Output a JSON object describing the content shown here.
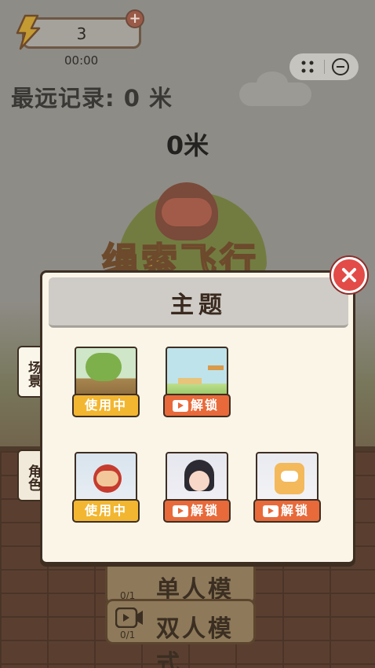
{
  "hud": {
    "energy_count": "3",
    "timer": "00:00",
    "best_record": "最远记录: 0 米",
    "distance": "0米"
  },
  "background": {
    "game_title": "绳索飞行",
    "buttons": [
      {
        "label": "单人模式",
        "count": "0/1"
      },
      {
        "label": "双人模式",
        "count": "0/1"
      }
    ]
  },
  "side_tabs": {
    "scene": "场景",
    "role": "角色"
  },
  "modal": {
    "title": "主题",
    "cards": [
      {
        "kind": "scene",
        "status": "使用中"
      },
      {
        "kind": "scene",
        "status": "解锁"
      },
      {
        "kind": "role",
        "status": "使用中"
      },
      {
        "kind": "role",
        "status": "解锁"
      },
      {
        "kind": "role",
        "status": "解锁"
      }
    ]
  },
  "colors": {
    "in_use": "#f2b630",
    "unlock": "#e86a3a",
    "close": "#e24b47"
  }
}
